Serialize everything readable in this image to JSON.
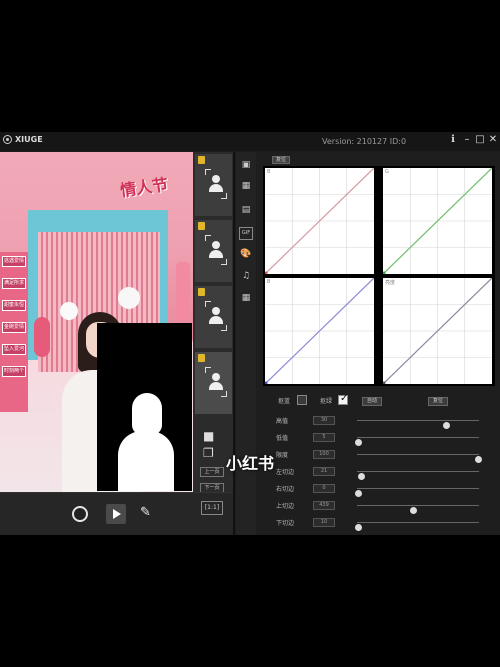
{
  "app": {
    "logo_text": "XIUGE",
    "version_text": "Version: 210127   ID:0",
    "window_controls": [
      {
        "icon": "info-icon",
        "glyph": "ℹ"
      },
      {
        "icon": "minimize-icon",
        "glyph": "–"
      },
      {
        "icon": "maximize-icon",
        "glyph": "□"
      },
      {
        "icon": "close-icon",
        "glyph": "✕"
      }
    ]
  },
  "preview": {
    "festival_text": "情人节",
    "side_labels": [
      "逃遇爱情",
      "满足所求",
      "甜蜜永恒",
      "金碗爱情",
      "坠入爱河",
      "时刻两个"
    ]
  },
  "scene_list": {
    "slot_icons": [
      "person-frame-icon",
      "person-icon",
      "person-icon",
      "person-frame-icon"
    ],
    "badge_icon": "file-badge-icon",
    "camera_icon": "video-camera-icon",
    "copy_icon": "copy-icon",
    "prev_label": "上一页",
    "next_label": "下一页",
    "ratio_label": "[1:1]"
  },
  "bottom_bar": {
    "record_icon": "record-icon",
    "play_icon": "play-icon",
    "pen_icon": "pen-icon"
  },
  "tools": [
    {
      "icon": "image-adjust-icon",
      "glyph": "▣"
    },
    {
      "icon": "film-icon",
      "glyph": "▦"
    },
    {
      "icon": "image-icon",
      "glyph": "▤"
    },
    {
      "icon": "gif-icon",
      "glyph": "GIF"
    },
    {
      "icon": "palette-icon",
      "glyph": "🎨"
    },
    {
      "icon": "music-icon",
      "glyph": "♫"
    },
    {
      "icon": "filmstrip-icon",
      "glyph": "▦"
    }
  ],
  "curves": {
    "reset_top_label": "复位",
    "graphs": [
      {
        "label": "B",
        "line_color": "#d49aa0",
        "start_color": "#cc4a4a"
      },
      {
        "label": "G",
        "line_color": "#6ebf6e",
        "start_color": "#35a035"
      },
      {
        "label": "B",
        "line_color": "#8b8bd6",
        "start_color": "#4a4ac0"
      },
      {
        "label": "亮度",
        "line_color": "#8a8aa0",
        "start_color": "#555"
      }
    ],
    "options": {
      "blue_screen_label": "抠蓝",
      "green_screen_label": "抠绿",
      "auto_label": "自动",
      "reset_label": "复位",
      "blue_checked": false,
      "green_checked": true
    }
  },
  "sliders": [
    {
      "label": "高值",
      "value": "30",
      "pos": 0.73
    },
    {
      "label": "低值",
      "value": "5",
      "pos": 0.01
    },
    {
      "label": "限度",
      "value": "100",
      "pos": 0.99
    },
    {
      "label": "左切边",
      "value": "21",
      "pos": 0.03
    },
    {
      "label": "右切边",
      "value": "0",
      "pos": 0.01
    },
    {
      "label": "上切边",
      "value": "439",
      "pos": 0.46
    },
    {
      "label": "下切边",
      "value": "10",
      "pos": 0.01
    }
  ],
  "watermark": "小红书"
}
